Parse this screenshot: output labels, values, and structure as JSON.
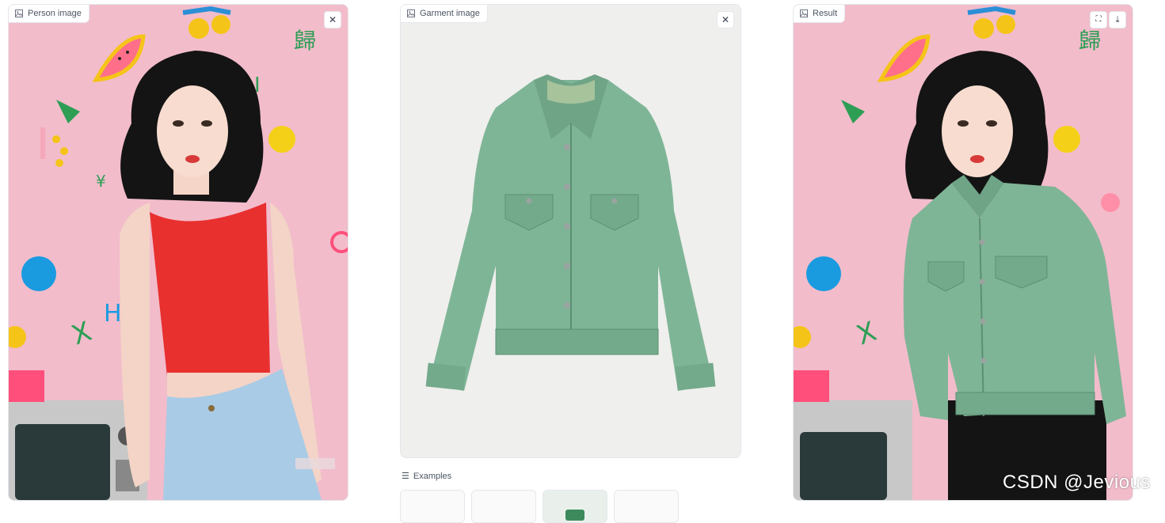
{
  "panels": {
    "person": {
      "label": "Person image",
      "clear_icon": "close-icon"
    },
    "garment": {
      "label": "Garment image",
      "clear_icon": "close-icon"
    },
    "result": {
      "label": "Result",
      "fullscreen_icon": "fullscreen-icon",
      "download_icon": "download-icon"
    }
  },
  "examples": {
    "label": "Examples"
  },
  "watermark": "CSDN @Jevious",
  "colors": {
    "background_pink": "#f2bccb",
    "tank_top": "#e8302f",
    "jeans": "#a9cbe6",
    "jacket": "#7fb597",
    "hair": "#141414"
  }
}
